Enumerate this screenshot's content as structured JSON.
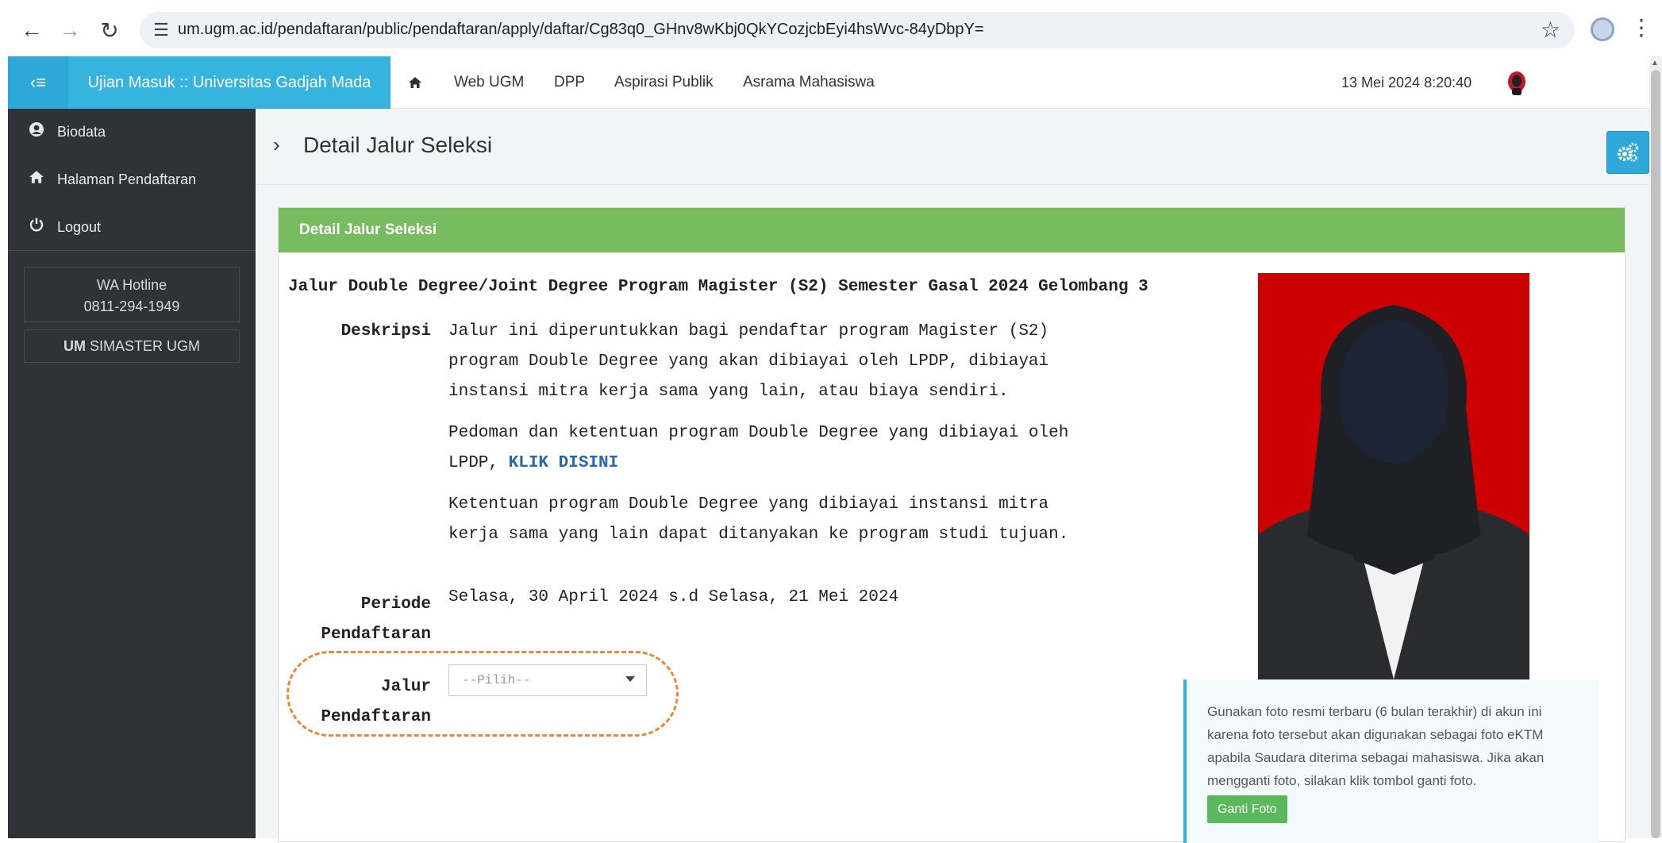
{
  "browser": {
    "url": "um.ugm.ac.id/pendaftaran/public/pendaftaran/apply/daftar/Cg83q0_GHnv8wKbj0QkYCozjcbEyi4hsWvc-84yDbpY="
  },
  "appbar": {
    "brand": "Ujian Masuk :: Universitas Gadjah Mada",
    "nav": [
      "Web UGM",
      "DPP",
      "Aspirasi Publik",
      "Asrama Mahasiswa"
    ],
    "datetime": "13 Mei 2024 8:20:40"
  },
  "sidebar": {
    "items": [
      {
        "label": "Biodata",
        "icon": "user-circle-icon"
      },
      {
        "label": "Halaman Pendaftaran",
        "icon": "home-icon"
      },
      {
        "label": "Logout",
        "icon": "power-icon"
      }
    ],
    "hotline_label": "WA Hotline",
    "hotline_number": "0811-294-1949",
    "simaster_strong": "UM",
    "simaster_text": "SIMASTER UGM"
  },
  "page": {
    "title": "Detail Jalur Seleksi",
    "panel_title": "Detail Jalur Seleksi",
    "program_title": "Jalur Double Degree/Joint Degree Program Magister (S2) Semester Gasal 2024 Gelombang 3",
    "deskripsi_label": "Deskripsi",
    "deskripsi_p1": "Jalur ini diperuntukkan bagi pendaftar program Magister (S2) program Double Degree yang akan dibiayai oleh LPDP, dibiayai instansi mitra kerja sama yang lain, atau biaya sendiri.",
    "deskripsi_p2_text": "Pedoman dan ketentuan program Double Degree yang dibiayai oleh LPDP, ",
    "deskripsi_p2_link": "KLIK DISINI",
    "deskripsi_p3": "Ketentuan program Double Degree yang dibiayai  instansi mitra kerja sama yang lain dapat ditanyakan ke program studi tujuan.",
    "periode_label_1": "Periode",
    "periode_label_2": "Pendaftaran",
    "periode_value": "Selasa, 30 April 2024 s.d Selasa, 21 Mei 2024",
    "jalur_label_1": "Jalur",
    "jalur_label_2": "Pendaftaran",
    "jalur_select": "--Pilih--",
    "photo_note": "Gunakan foto resmi terbaru (6 bulan terakhir) di akun ini karena foto tersebut akan digunakan sebagai foto eKTM apabila Saudara diterima sebagai mahasiswa. Jika akan mengganti foto, silakan klik tombol ganti foto.",
    "ganti_foto": "Ganti Foto"
  },
  "colors": {
    "brand_blue": "#37b3e0",
    "panel_green": "#77bc5f",
    "sidebar_dark": "#2f3338",
    "highlight_orange": "#e58a3a"
  }
}
